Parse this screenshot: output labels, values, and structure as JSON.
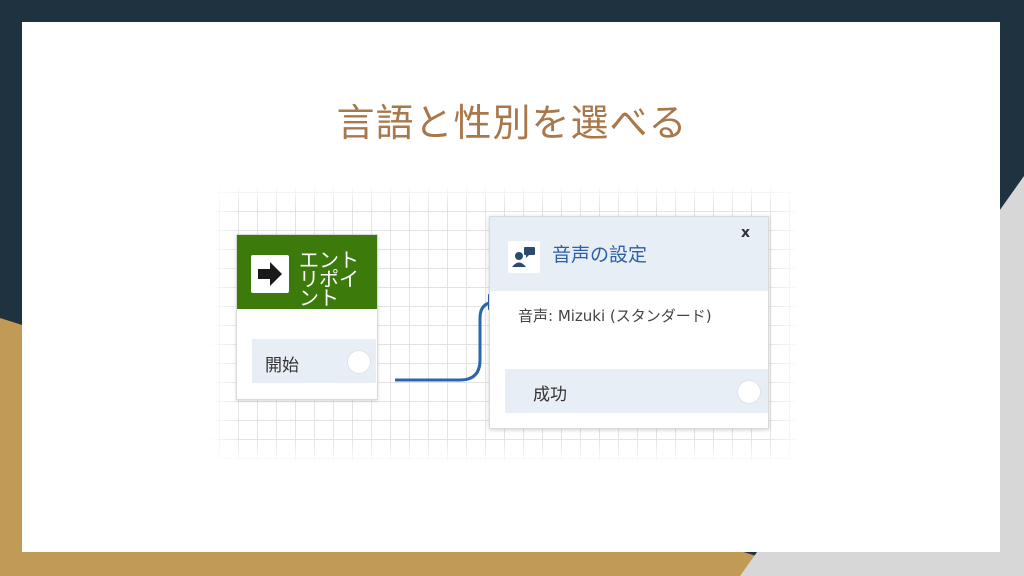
{
  "colors": {
    "background": "#1f3240",
    "gold": "#c19a55",
    "title": "#a9784a",
    "entry_green": "#3b7a0b",
    "accent_blue": "#2b5fa8"
  },
  "slide": {
    "title": "言語と性別を選べる"
  },
  "entry_block": {
    "title": "エントリポイント",
    "icon": "arrow-right-icon",
    "start_label": "開始"
  },
  "voice_block": {
    "title": "音声の設定",
    "icon": "person-speech-icon",
    "close_label": "x",
    "value": "音声: Mizuki (スタンダード)",
    "success_label": "成功"
  }
}
